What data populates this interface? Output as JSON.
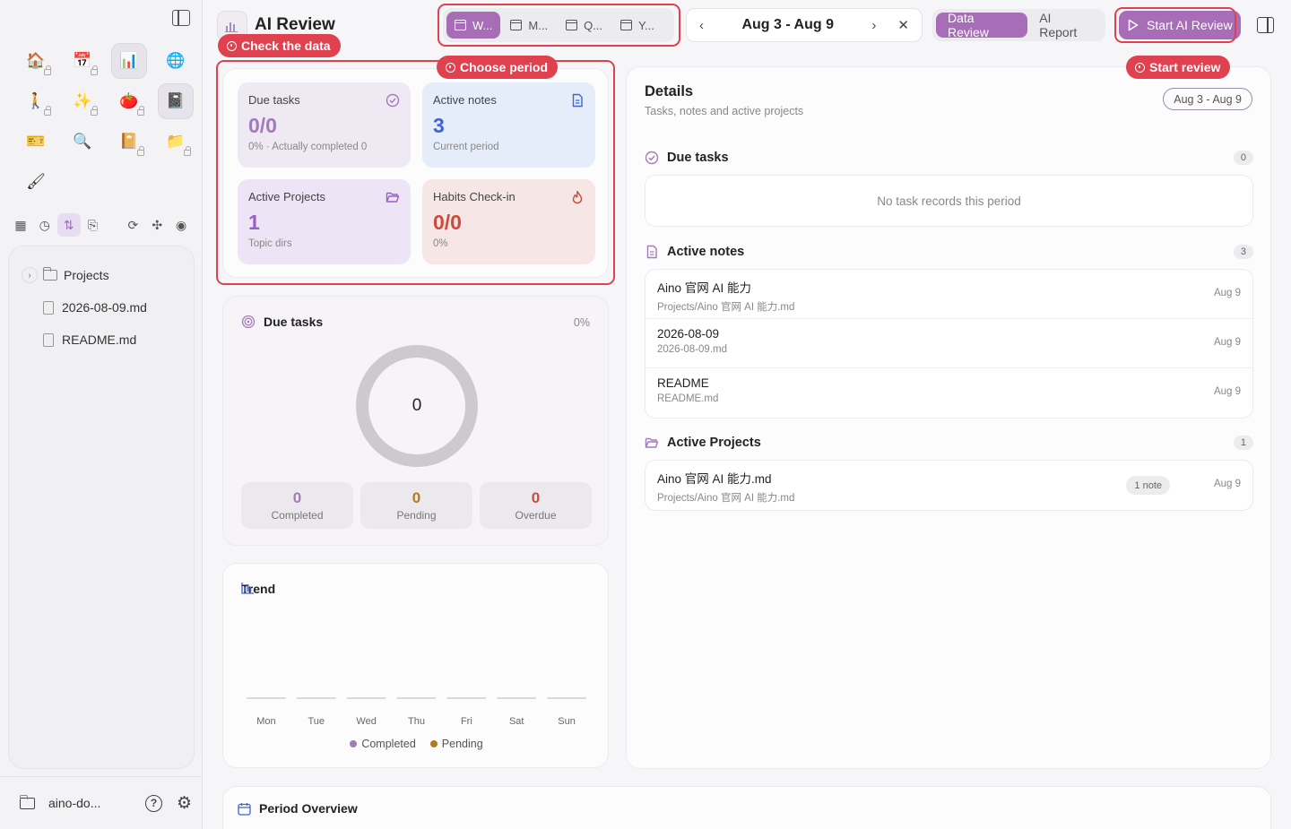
{
  "app": {
    "title": "AI Review"
  },
  "sidebar": {
    "apps": [
      {
        "icon": "home-icon",
        "glyph": "🏠",
        "locked": true
      },
      {
        "icon": "calendar-icon",
        "glyph": "📅",
        "locked": true
      },
      {
        "icon": "bar-chart-icon",
        "glyph": "📊",
        "locked": false,
        "active": true
      },
      {
        "icon": "globe-icon",
        "glyph": "🌐",
        "locked": false
      },
      {
        "icon": "walk-icon",
        "glyph": "🚶",
        "locked": true
      },
      {
        "icon": "sparkle-icon",
        "glyph": "✨",
        "locked": true
      },
      {
        "icon": "tomato-icon",
        "glyph": "🍅",
        "locked": true
      },
      {
        "icon": "notebook-icon",
        "glyph": "📓",
        "locked": false,
        "active": true
      },
      {
        "icon": "ticket-icon",
        "glyph": "🎫",
        "locked": false
      },
      {
        "icon": "magnifier-icon",
        "glyph": "🔍",
        "locked": false
      },
      {
        "icon": "book-icon",
        "glyph": "📔",
        "locked": true
      },
      {
        "icon": "folder-icon",
        "glyph": "📁",
        "locked": true
      },
      {
        "icon": "brush-icon",
        "glyph": "🖌",
        "locked": false
      }
    ],
    "tree": {
      "folder": "Projects",
      "files": [
        "2026-08-09.md",
        "README.md"
      ]
    },
    "workspace": "aino-do...",
    "help": "?"
  },
  "header": {
    "period_tabs": [
      "W...",
      "M...",
      "Q...",
      "Y..."
    ],
    "range": "Aug 3 - Aug 9",
    "views": [
      "Data Review",
      "AI Report"
    ],
    "start_label": "Start AI Review"
  },
  "annotations": {
    "check": "Check the data",
    "period": "Choose period",
    "start": "Start review"
  },
  "stats": {
    "due": {
      "label": "Due tasks",
      "value": "0/0",
      "sub": "0% · Actually completed 0"
    },
    "notes": {
      "label": "Active notes",
      "value": "3",
      "sub": "Current period"
    },
    "projects": {
      "label": "Active Projects",
      "value": "1",
      "sub": "Topic dirs"
    },
    "habits": {
      "label": "Habits Check-in",
      "value": "0/0",
      "sub": "0%"
    }
  },
  "due_card": {
    "title": "Due tasks",
    "percent": "0%",
    "center": "0",
    "progress": 0,
    "completed": {
      "value": "0",
      "label": "Completed",
      "color": "#a47ab8"
    },
    "pending": {
      "value": "0",
      "label": "Pending",
      "color": "#b07a1e"
    },
    "overdue": {
      "value": "0",
      "label": "Overdue",
      "color": "#cf4a3a"
    }
  },
  "trend": {
    "title": "Trend",
    "legend": [
      {
        "name": "Completed",
        "color": "#a47ab8"
      },
      {
        "name": "Pending",
        "color": "#b07a1e"
      }
    ]
  },
  "chart_data": {
    "type": "bar",
    "categories": [
      "Mon",
      "Tue",
      "Wed",
      "Thu",
      "Fri",
      "Sat",
      "Sun"
    ],
    "series": [
      {
        "name": "Completed",
        "values": [
          0,
          0,
          0,
          0,
          0,
          0,
          0
        ]
      },
      {
        "name": "Pending",
        "values": [
          0,
          0,
          0,
          0,
          0,
          0,
          0
        ]
      }
    ],
    "title": "Trend"
  },
  "details": {
    "title": "Details",
    "subtitle": "Tasks, notes and active projects",
    "range": "Aug 3 - Aug 9",
    "due": {
      "title": "Due tasks",
      "count": "0",
      "empty": "No task records this period"
    },
    "notes": {
      "title": "Active notes",
      "count": "3",
      "items": [
        {
          "title": "Aino 官网 AI 能力",
          "path": "Projects/Aino 官网 AI 能力.md",
          "date": "Aug 9"
        },
        {
          "title": "2026-08-09",
          "path": "2026-08-09.md",
          "date": "Aug 9"
        },
        {
          "title": "README",
          "path": "README.md",
          "date": "Aug 9"
        }
      ]
    },
    "projects": {
      "title": "Active Projects",
      "count": "1",
      "items": [
        {
          "title": "Aino 官网 AI 能力.md",
          "path": "Projects/Aino 官网 AI 能力.md",
          "pill": "1 note",
          "date": "Aug 9"
        }
      ]
    }
  },
  "overview": {
    "title": "Period Overview"
  }
}
